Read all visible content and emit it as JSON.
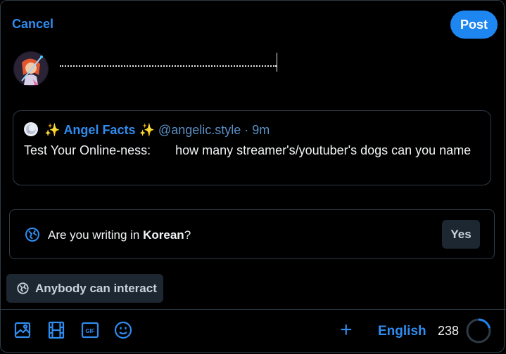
{
  "header": {
    "cancel_label": "Cancel",
    "post_label": "Post"
  },
  "composer": {
    "avatar_icon": "user-avatar-anime-character"
  },
  "quote": {
    "avatar_icon": "moon-avatar",
    "sparkle_left": "✨",
    "author_name": "Angel Facts",
    "sparkle_right": "✨",
    "handle": "@angelic.style",
    "separator": " · ",
    "time": "9m",
    "text": "Test Your Online-ness:       how many streamer's/youtuber's dogs can you name"
  },
  "language_prompt": {
    "icon": "globe-language-icon",
    "prefix": "Are you writing in ",
    "language": "Korean",
    "suffix": "?",
    "yes_label": "Yes"
  },
  "interaction": {
    "icon": "globe-lock-icon",
    "label": "Anybody can interact"
  },
  "toolbar": {
    "icons": [
      "image-icon",
      "video-icon",
      "gif-icon",
      "emoji-icon"
    ],
    "gif_text": "GIF",
    "add_icon": "plus-icon",
    "language_label": "English",
    "char_count": "238",
    "char_progress": 0.21
  },
  "colors": {
    "accent": "#1e86f1",
    "link": "#2f8cf0",
    "border": "#2e3a46",
    "chip_bg": "#1d2731",
    "background": "#000000"
  }
}
